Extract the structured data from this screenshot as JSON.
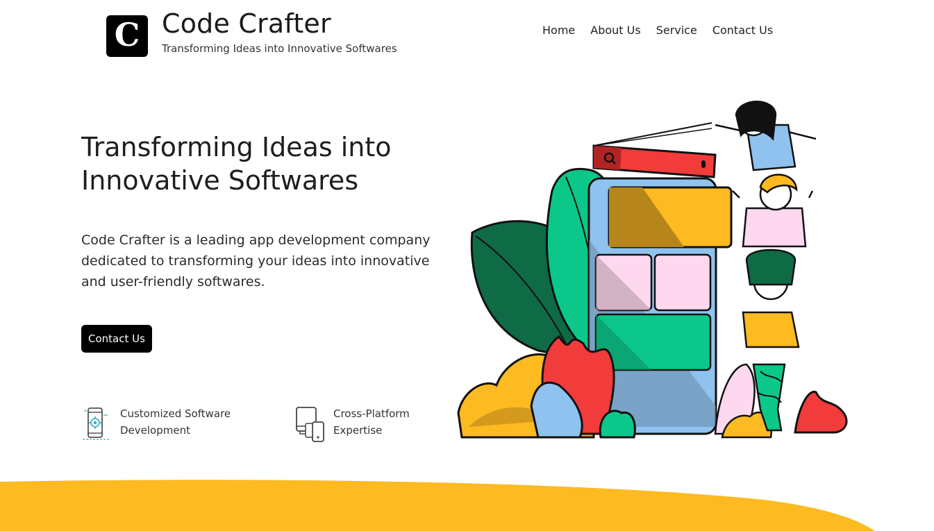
{
  "brand": {
    "logo_letter": "C",
    "name": "Code Crafter",
    "tagline": "Transforming Ideas into Innovative Softwares"
  },
  "nav": {
    "items": [
      {
        "label": "Home"
      },
      {
        "label": "About Us"
      },
      {
        "label": "Service"
      },
      {
        "label": "Contact Us"
      }
    ]
  },
  "hero": {
    "title": "Transforming Ideas into Innovative Softwares",
    "description": "Code Crafter is a leading app development company dedicated to transforming your ideas into innovative and user-friendly softwares.",
    "cta_label": "Contact Us"
  },
  "features": [
    {
      "label": "Customized Software Development",
      "icon": "mobile-gear-icon"
    },
    {
      "label": "Cross-Platform Expertise",
      "icon": "devices-icon"
    }
  ],
  "colors": {
    "accent_yellow": "#FDBA21",
    "black": "#000000",
    "red": "#F23B3B",
    "green": "#0CC78A",
    "blue": "#8FC2EE",
    "pink": "#FDD8EF"
  }
}
